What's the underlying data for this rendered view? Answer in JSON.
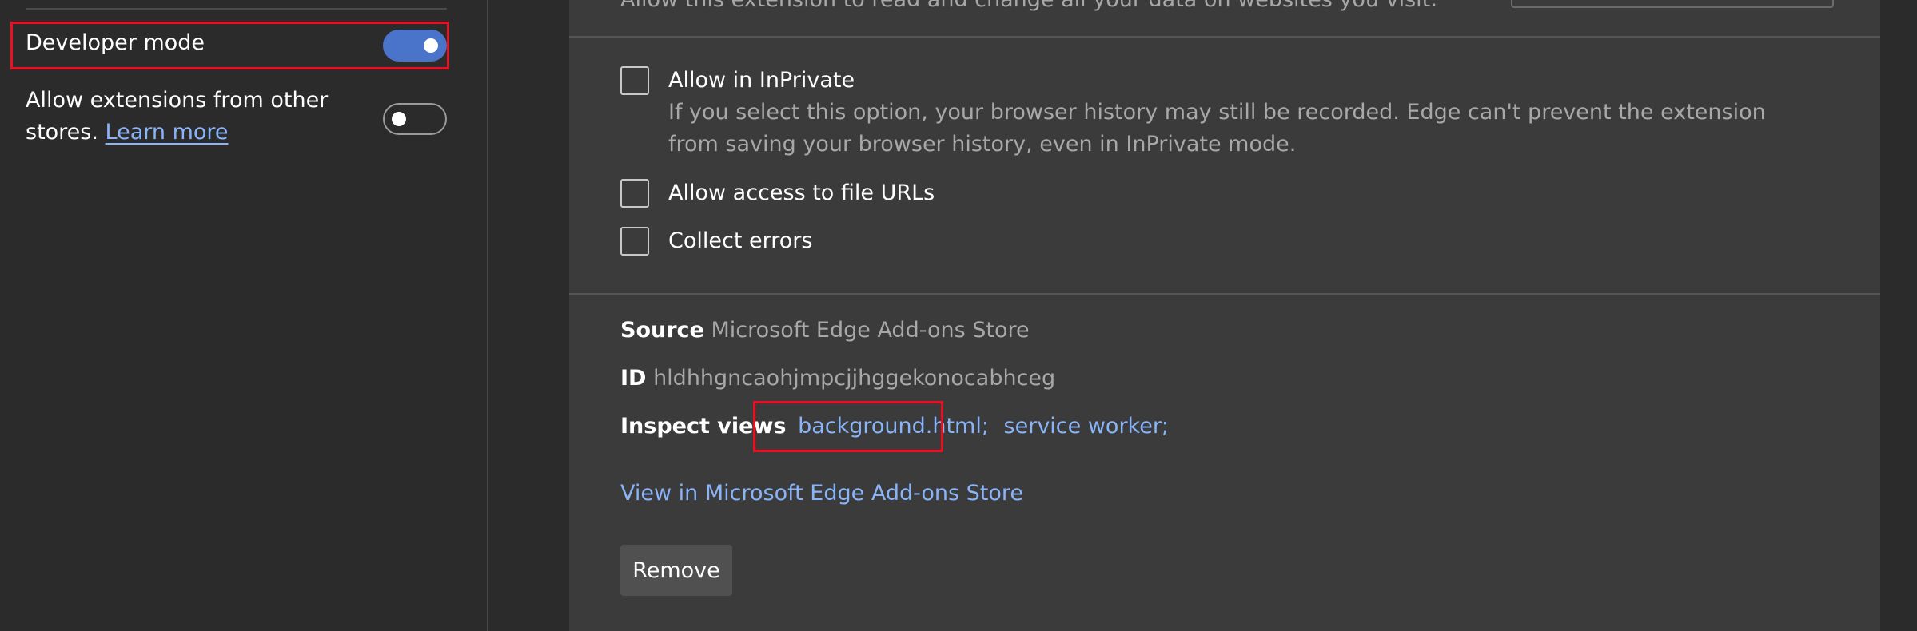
{
  "sidebar": {
    "developer_mode": {
      "label": "Developer mode",
      "enabled": true
    },
    "other_stores": {
      "label": "Allow extensions from other stores.",
      "link": "Learn more",
      "enabled": false
    }
  },
  "details": {
    "site_access_text": "Allow this extension to read and change all your data on websites you visit:",
    "options": [
      {
        "label": "Allow in InPrivate",
        "description": "If you select this option, your browser history may still be recorded. Edge can't prevent the extension from saving your browser history, even in InPrivate mode.",
        "checked": false
      },
      {
        "label": "Allow access to file URLs",
        "checked": false
      },
      {
        "label": "Collect errors",
        "checked": false
      }
    ],
    "source": {
      "key": "Source",
      "value": "Microsoft Edge Add-ons Store"
    },
    "id": {
      "key": "ID",
      "value": "hldhhgncaohjmpcjjhggekonocabhceg"
    },
    "inspect_views": {
      "key": "Inspect views",
      "links": [
        "background.html;",
        "service worker;"
      ]
    },
    "store_link": "View in Microsoft Edge Add-ons Store",
    "remove_label": "Remove"
  },
  "colors": {
    "accent": "#4a74c9",
    "link": "#8ab4f8",
    "highlight": "#e81123"
  }
}
